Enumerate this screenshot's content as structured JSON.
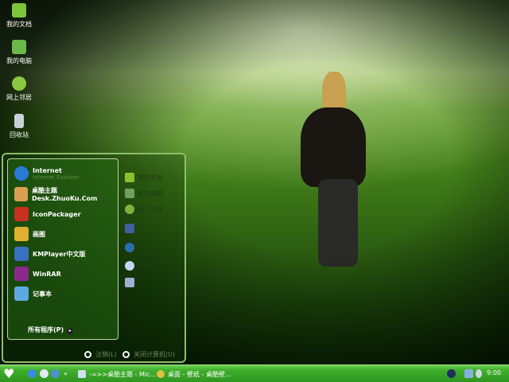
{
  "desktop_icons": [
    {
      "label": "我的文档",
      "icon": "folder-icon",
      "color": "#7cc43a"
    },
    {
      "label": "我的电脑",
      "icon": "house-icon",
      "color": "#6ab84a"
    },
    {
      "label": "网上邻居",
      "icon": "globe-icon",
      "color": "#8ac840"
    },
    {
      "label": "回收站",
      "icon": "recycle-bin-icon",
      "color": "#c8d0d8"
    }
  ],
  "start_menu": {
    "programs": [
      {
        "label": "Internet",
        "sub": "Internet Explorer",
        "icon": "ie-icon",
        "color": "#2a7ad8"
      },
      {
        "label": "桌酷主题Desk.ZhuoKu.Com",
        "icon": "zhuoku-icon",
        "color": "#d8a050"
      },
      {
        "label": "IconPackager",
        "icon": "iconpackager-icon",
        "color": "#c83020"
      },
      {
        "label": "画图",
        "icon": "paint-icon",
        "color": "#e0b030"
      },
      {
        "label": "KMPlayer中文版",
        "icon": "kmplayer-icon",
        "color": "#3a70c0"
      },
      {
        "label": "WinRAR",
        "icon": "winrar-icon",
        "color": "#8a2a8a"
      },
      {
        "label": "记事本",
        "icon": "notepad-icon",
        "color": "#60a8e0"
      }
    ],
    "all_programs": "所有程序(P)",
    "places": [
      {
        "label": "我的文档",
        "icon": "folder-icon",
        "color": "#8ac030"
      },
      {
        "label": "我的电脑",
        "icon": "house-icon",
        "color": "#70a060"
      },
      {
        "label": "网上邻居",
        "icon": "globe-icon",
        "color": "#80b040"
      },
      {
        "label": "",
        "icon": "control-panel-icon",
        "color": "#4060a0"
      },
      {
        "label": "",
        "icon": "network-icon",
        "color": "#2a70b0"
      },
      {
        "label": "搜索(S)",
        "icon": "search-icon",
        "color": "#c0d8f0"
      },
      {
        "label": "",
        "icon": "run-icon",
        "color": "#a0b0d0"
      }
    ],
    "logoff": "注销(L)",
    "shutdown": "关闭计算机(U)"
  },
  "taskbar": {
    "start_icon": "heart-icon",
    "quick_launch": [
      {
        "icon": "ie-icon",
        "color": "#3a8ae0"
      },
      {
        "icon": "browser-icon",
        "color": "#e0e8f0"
      },
      {
        "icon": "media-icon",
        "color": "#5090d0"
      }
    ],
    "more": "»",
    "tasks": [
      {
        "label": "-=>>桌酷主题 - Mic...",
        "icon": "document-icon",
        "color": "#d0e0f0"
      },
      {
        "label": "桌面 - 壁纸 - 桌酷壁...",
        "icon": "chrome-icon",
        "color": "#e0c040"
      }
    ],
    "tray": [
      {
        "icon": "back-arrow-icon",
        "color": "#203060"
      },
      {
        "icon": "network-tray-icon",
        "color": "#8ab0e0"
      },
      {
        "icon": "volume-icon",
        "color": "#d0d8e0"
      }
    ],
    "clock": "9:00"
  }
}
